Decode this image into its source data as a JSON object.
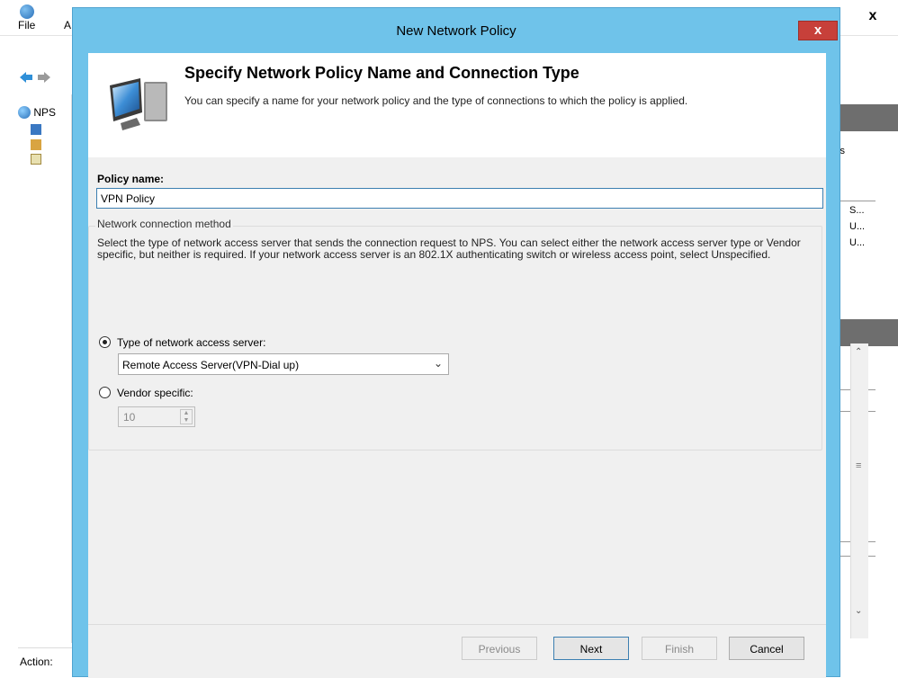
{
  "background_window": {
    "menu": [
      "File",
      "A"
    ],
    "tree_root": "NPS",
    "status_label": "Action:",
    "close_glyph": "x",
    "right_pane_text": [
      "ss",
      "S...",
      "U...",
      "U..."
    ]
  },
  "dialog": {
    "title": "New Network Policy",
    "close_glyph": "x",
    "header": {
      "title": "Specify Network Policy Name and Connection Type",
      "subtitle": "You can specify a name for your network policy and the type of connections to which the policy is applied."
    },
    "policy_name": {
      "label": "Policy name:",
      "value": "VPN Policy"
    },
    "connection_method": {
      "legend": "Network connection method",
      "description": "Select the type of network access server that sends the connection request to NPS. You can select either the network access server type or Vendor specific, but neither is required.  If your network access server is an 802.1X authenticating switch or wireless access point, select Unspecified.",
      "option_type_label": "Type of network access server:",
      "option_type_selected": true,
      "server_type_value": "Remote Access Server(VPN-Dial up)",
      "option_vendor_label": "Vendor specific:",
      "option_vendor_selected": false,
      "vendor_value": "10"
    },
    "buttons": {
      "previous": "Previous",
      "next": "Next",
      "finish": "Finish",
      "cancel": "Cancel"
    }
  },
  "colors": {
    "titlebar": "#6fc3ea",
    "close_button": "#c7403a",
    "client_bg": "#f0f0f0",
    "focus_border": "#3c7fb1"
  }
}
